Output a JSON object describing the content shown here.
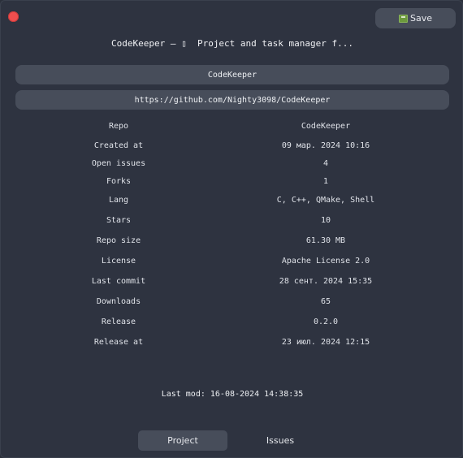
{
  "window": {
    "title": "CodeKeeper — ▯  Project and task manager f...",
    "save_label": "Save"
  },
  "fields": {
    "name": "CodeKeeper",
    "url": "https://github.com/Nighty3098/CodeKeeper"
  },
  "info": [
    {
      "key": "Repo",
      "value": "CodeKeeper"
    },
    {
      "key": "Created at",
      "value": "09 мар. 2024 10:16"
    },
    {
      "key": "Open issues",
      "value": "4"
    },
    {
      "key": "Forks",
      "value": "1"
    },
    {
      "key": "Lang",
      "value": "C, C++, QMake, Shell"
    },
    {
      "key": "Stars",
      "value": "10"
    },
    {
      "key": "Repo size",
      "value": "61.30 MB"
    },
    {
      "key": "License",
      "value": "Apache License 2.0"
    },
    {
      "key": "Last commit",
      "value": "28 сент. 2024 15:35"
    },
    {
      "key": "Downloads",
      "value": "65"
    },
    {
      "key": "Release",
      "value": "0.2.0"
    },
    {
      "key": "Release at",
      "value": "23 июл. 2024 12:15"
    }
  ],
  "footer": {
    "last_mod": "Last mod: 16-08-2024 14:38:35"
  },
  "tabs": {
    "project": "Project",
    "issues": "Issues"
  },
  "colors": {
    "background": "#2e3340",
    "field": "#474d5a",
    "close": "#ef4e4e"
  },
  "icons": {
    "close": "close-dot-icon",
    "save": "save-disk-icon"
  }
}
